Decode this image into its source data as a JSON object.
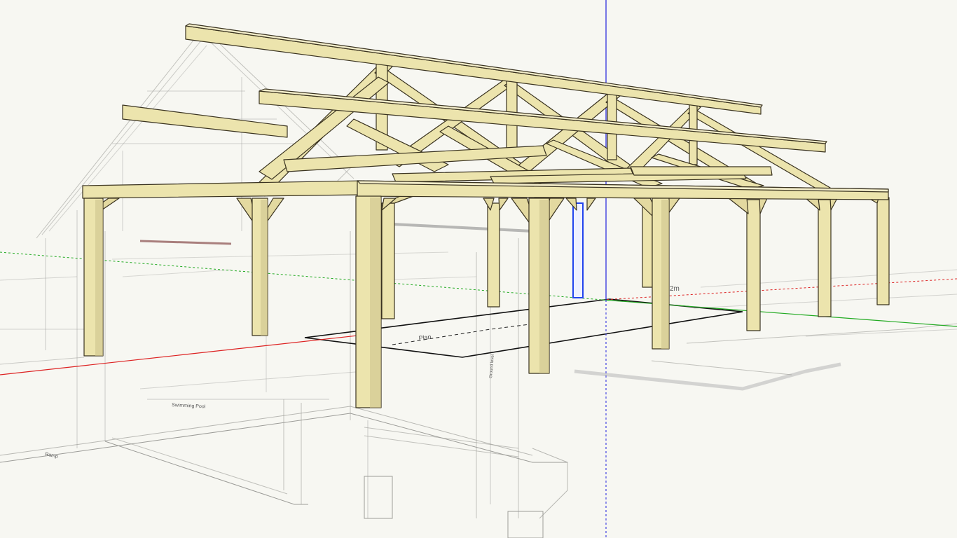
{
  "app": {
    "view": "perspective-3d-modeling-viewport"
  },
  "scene": {
    "model": "timber-frame-pavilion",
    "underlay": "architectural-section-drawing"
  },
  "labels": {
    "dim_left_bottom": "Swimming Pool",
    "dim_plan": "Plan",
    "dim_bottom_left": "Ramp",
    "dim_right": "2m",
    "dim_vertical": "Ground level"
  },
  "axes": {
    "red": "#d22",
    "green": "#2a2",
    "blue": "#22d"
  },
  "colors": {
    "timber": "#ece4ad",
    "timber_dark": "#c9be86",
    "timber_edge": "#3a3320",
    "background": "#f7f7f2",
    "selection": "#2244ee"
  }
}
